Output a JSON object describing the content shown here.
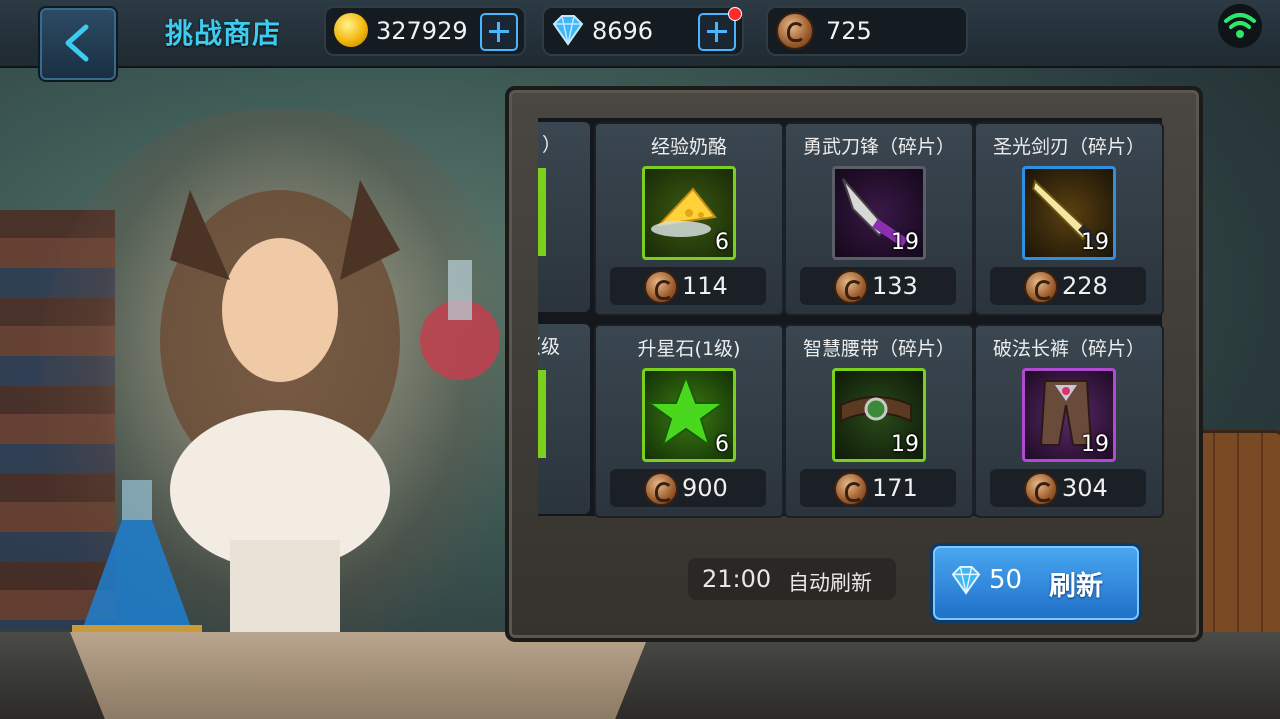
{
  "header": {
    "title": "挑战商店",
    "gold": "327929",
    "diamonds": "8696",
    "challenge_coins": "725"
  },
  "shop": {
    "items": [
      {
        "name": "经验奶酪",
        "qty": "6",
        "price": "114",
        "rarity": "green"
      },
      {
        "name": "勇武刀锋（碎片）",
        "qty": "19",
        "price": "133",
        "rarity": "purple"
      },
      {
        "name": "圣光剑刃（碎片）",
        "qty": "19",
        "price": "228",
        "rarity": "blue"
      },
      {
        "name": "升星石(1级)",
        "qty": "6",
        "price": "900",
        "rarity": "green"
      },
      {
        "name": "智慧腰带（碎片）",
        "qty": "19",
        "price": "171",
        "rarity": "green"
      },
      {
        "name": "破法长裤（碎片）",
        "qty": "19",
        "price": "304",
        "rarity": "purple"
      }
    ],
    "partial_top_label": "）",
    "partial_bottom_label": "级）"
  },
  "refresh": {
    "time": "21:00",
    "auto_label": "自动刷新",
    "cost": "50",
    "button_label": "刷新"
  },
  "colors": {
    "accent": "#3ecbf0",
    "green_border": "#7bd01e",
    "purple_border": "#7a4a9a",
    "blue_border": "#2f8fe0"
  }
}
